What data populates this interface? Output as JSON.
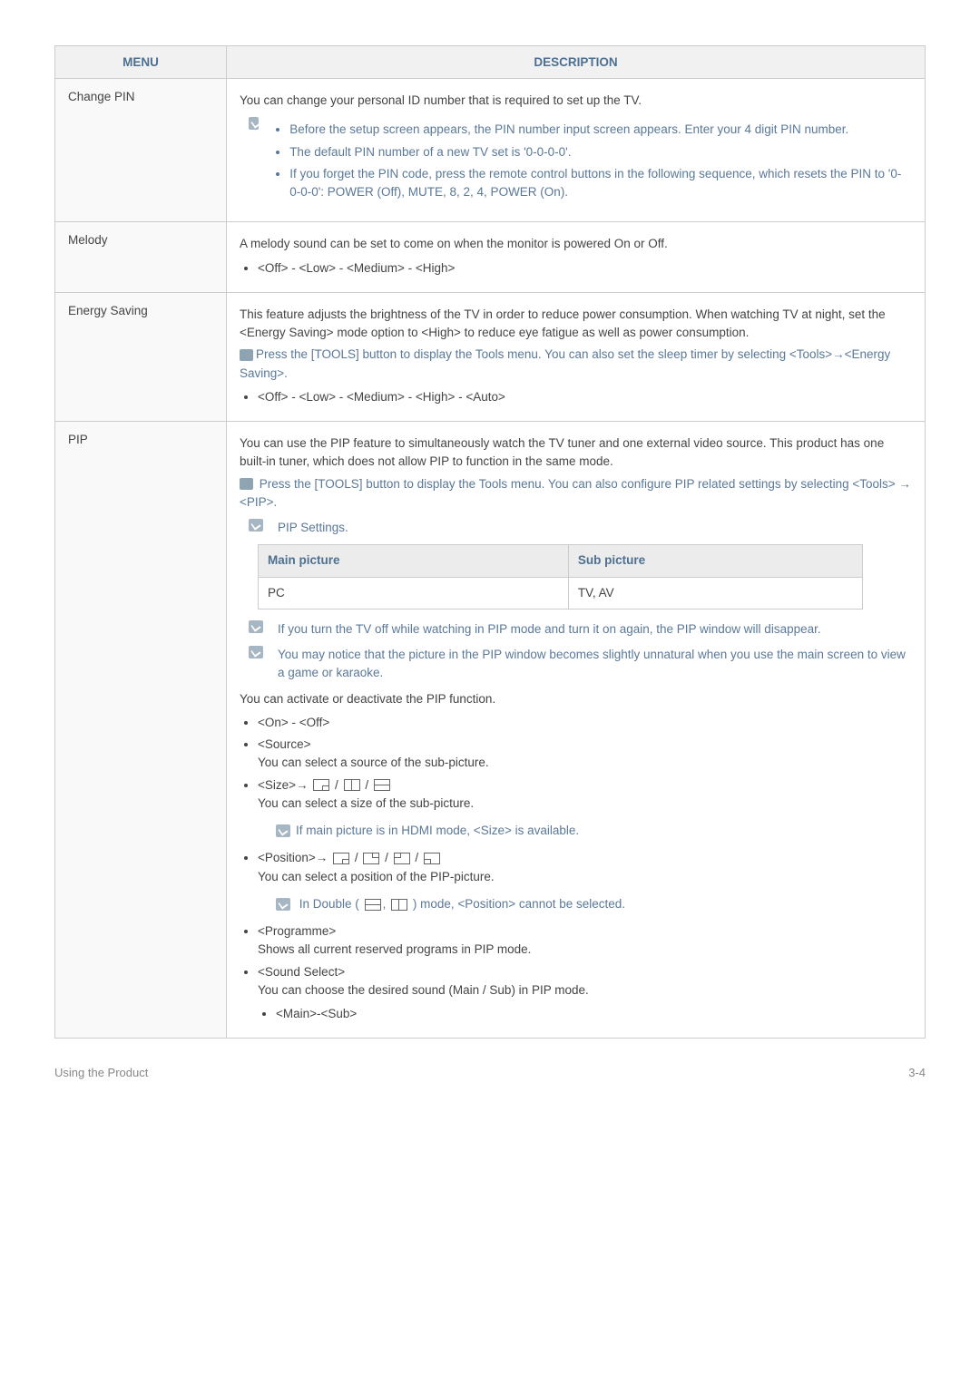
{
  "headers": {
    "menu": "MENU",
    "desc": "DESCRIPTION"
  },
  "rows": {
    "changepin": {
      "menu": "Change PIN",
      "intro": "You can change your personal ID number that is required to set up the TV.",
      "notes": {
        "n1": "Before the setup screen appears, the PIN number input screen appears. Enter your 4 digit PIN number.",
        "n2": "The default PIN number of a new TV set is '0-0-0-0'.",
        "n3": "If you forget the PIN code, press the remote control buttons in the following sequence, which resets the PIN to '0-0-0-0': POWER (Off), MUTE, 8, 2, 4, POWER (On)."
      }
    },
    "melody": {
      "menu": "Melody",
      "intro": "A melody sound can be set to come on when the monitor is powered On or Off.",
      "opt": "<Off> - <Low> - <Medium> - <High>"
    },
    "energy": {
      "menu": "Energy Saving",
      "intro": "This feature adjusts the brightness of the TV in order to reduce power consumption. When watching TV at night, set the <Energy Saving> mode option to <High> to reduce eye fatigue as well as power consumption.",
      "tip": "Press the [TOOLS] button to display the Tools menu. You can also set the sleep timer by selecting <Tools>→<Energy Saving>.",
      "opt": "<Off> - <Low> - <Medium> - <High> - <Auto>"
    },
    "pip": {
      "menu": "PIP",
      "intro": "You can use the PIP feature to simultaneously watch the TV tuner and one external video source. This product has one built-in tuner, which does not allow PIP to function in the same mode.",
      "tip": " Press the [TOOLS] button to display the Tools menu. You can also configure PIP related settings by selecting <Tools> → <PIP>.",
      "settingslabel": "PIP Settings.",
      "table": {
        "h1": "Main picture",
        "h2": "Sub picture",
        "c1": "PC",
        "c2": "TV, AV"
      },
      "note1": "If you turn the TV off while watching in PIP mode and turn it on again, the PIP window will disappear.",
      "note2": "You may notice that the picture in the PIP window becomes slightly unnatural when you use the main screen to view a game or karaoke.",
      "activ": "You can activate or deactivate the PIP function.",
      "onoff": "<On> - <Off>",
      "src": {
        "lbl": "<Source>",
        "txt": "You can select a source of the sub-picture."
      },
      "size": {
        "lbl": "<Size>→",
        "txt": "You can select a size of the sub-picture.",
        "note": "If main picture is in HDMI mode, <Size> is available."
      },
      "pos": {
        "lbl": "<Position>→",
        "txt": "You can select a position of the PIP-picture.",
        "note_a": "In Double (",
        "note_b": ") mode, <Position> cannot be selected."
      },
      "prog": {
        "lbl": "<Programme>",
        "txt": "Shows all current reserved programs in PIP mode."
      },
      "snd": {
        "lbl": "<Sound Select>",
        "txt": "You can choose the desired sound (Main / Sub) in PIP mode.",
        "opt": "<Main>-<Sub>"
      }
    }
  },
  "footer": {
    "left": "Using the Product",
    "right": "3-4"
  }
}
